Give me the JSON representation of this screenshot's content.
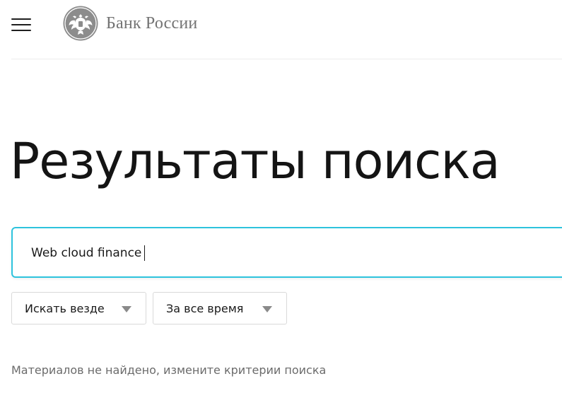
{
  "header": {
    "bank_name": "Банк России",
    "menu_icon": "hamburger-menu-icon",
    "emblem_icon": "double-headed-eagle-emblem-icon"
  },
  "main": {
    "title": "Результаты поиска",
    "search": {
      "value": "Web cloud finance",
      "border_color": "#2ec3dd"
    },
    "filters": [
      {
        "label": "Искать везде",
        "icon": "triangle-down-icon"
      },
      {
        "label": "За все время",
        "icon": "triangle-down-icon"
      }
    ],
    "empty_message": "Материалов не найдено, измените критерии поиска"
  }
}
